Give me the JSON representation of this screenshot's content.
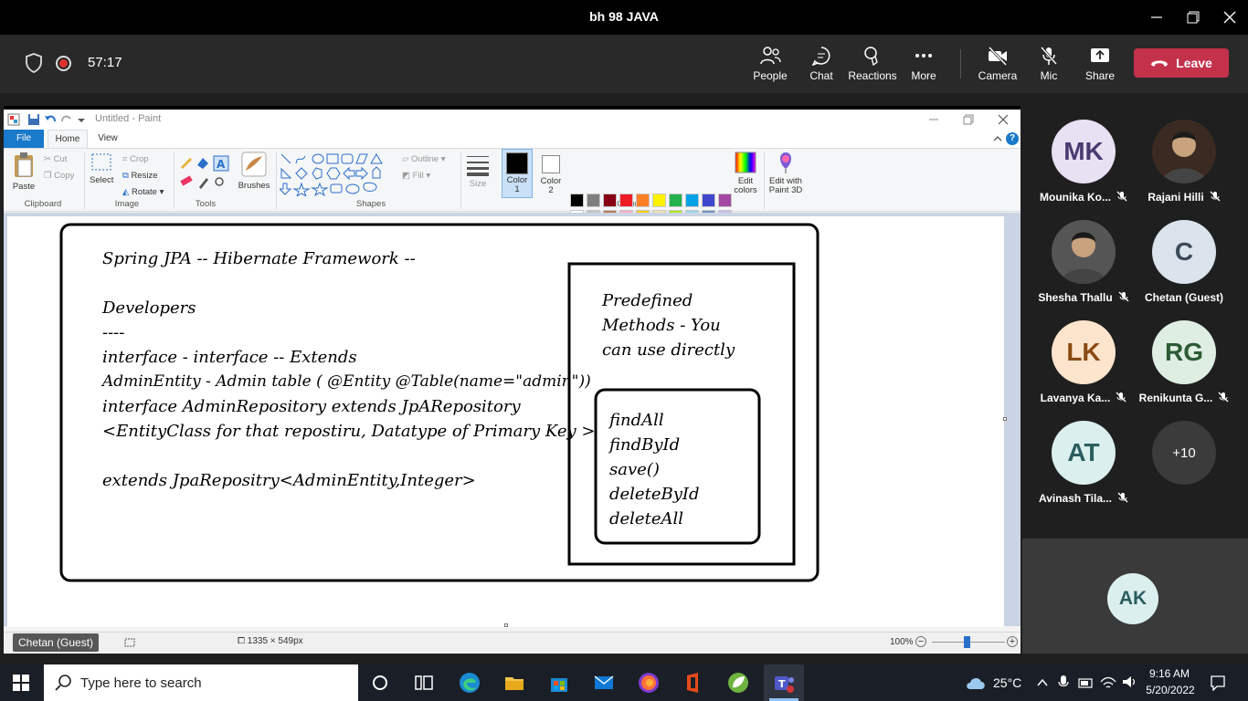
{
  "window": {
    "title": "bh 98 JAVA"
  },
  "meeting": {
    "timer": "57:17",
    "buttons": {
      "people": "People",
      "chat": "Chat",
      "reactions": "Reactions",
      "more": "More",
      "camera": "Camera",
      "mic": "Mic",
      "share": "Share"
    },
    "leave_label": "Leave",
    "leave_color": "#c4314b"
  },
  "paint": {
    "window_title": "Untitled - Paint",
    "tabs": {
      "file": "File",
      "home": "Home",
      "view": "View"
    },
    "ribbon": {
      "clipboard": {
        "paste": "Paste",
        "cut": "Cut",
        "copy": "Copy",
        "label": "Clipboard"
      },
      "image": {
        "select": "Select",
        "crop": "Crop",
        "resize": "Resize",
        "rotate": "Rotate",
        "label": "Image"
      },
      "tools": {
        "label": "Tools"
      },
      "brushes": {
        "label": "Brushes"
      },
      "shapes": {
        "outline": "Outline",
        "fill": "Fill",
        "label": "Shapes"
      },
      "size": {
        "label": "Size"
      },
      "colors": {
        "color1": "Color",
        "color1_num": "1",
        "color2": "Color",
        "color2_num": "2",
        "edit": "Edit",
        "edit2": "colors",
        "label": "Colors",
        "palette_row1": [
          "#000000",
          "#7f7f7f",
          "#880015",
          "#ed1c24",
          "#ff7f27",
          "#fff200",
          "#22b14c",
          "#00a2e8",
          "#3f48cc",
          "#a349a4"
        ],
        "palette_row2": [
          "#ffffff",
          "#c3c3c3",
          "#b97a57",
          "#ffaec9",
          "#ffc90e",
          "#efe4b0",
          "#b5e61d",
          "#99d9ea",
          "#7092be",
          "#c8bfe7"
        ]
      },
      "paint3d": {
        "line1": "Edit with",
        "line2": "Paint 3D"
      }
    },
    "drawing": {
      "title": "Spring JPA -- Hibernate Framework --",
      "lines": [
        "Developers",
        "----",
        "interface - interface -- Extends",
        "AdminEntity - Admin table  ( @Entity @Table(name=\"admin\"))",
        "interface AdminRepository extends JpARepository",
        "<EntityClass for that repostiru, Datatype of Primary Key >",
        "",
        "extends JpaRepositry<AdminEntity,Integer>"
      ],
      "box_text": [
        "Predefined",
        "Methods - You",
        "can use directly"
      ],
      "methods": [
        "findAll",
        "findById",
        "save()",
        "deleteById",
        "deleteAll"
      ]
    },
    "status": {
      "dimensions": "1335 × 549px",
      "zoom": "100%"
    },
    "presenter_chip": "Chetan (Guest)"
  },
  "participants": [
    {
      "initials": "MK",
      "name": "Mounika Ko...",
      "bg": "#e8e1f3",
      "fg": "#4a3a70",
      "muted": true
    },
    {
      "initials": "",
      "name": "Rajani Hilli",
      "bg": "#3a2a22",
      "fg": "#fff",
      "muted": true,
      "photo": true
    },
    {
      "initials": "",
      "name": "Shesha Thallu",
      "bg": "#555",
      "fg": "#fff",
      "muted": true,
      "photo": true
    },
    {
      "initials": "C",
      "name": "Chetan (Guest)",
      "bg": "#dbe4ec",
      "fg": "#3c4b59",
      "muted": false
    },
    {
      "initials": "LK",
      "name": "Lavanya Ka...",
      "bg": "#fde4cc",
      "fg": "#8a4a12",
      "muted": true
    },
    {
      "initials": "RG",
      "name": "Renikunta G...",
      "bg": "#dfeee2",
      "fg": "#2c5a37",
      "muted": true
    },
    {
      "initials": "AT",
      "name": "Avinash Tila...",
      "bg": "#dcefef",
      "fg": "#2a5e60",
      "muted": true
    },
    {
      "initials": "+10",
      "name": "",
      "bg": "#3b3b3b",
      "fg": "#fff",
      "muted": false
    }
  ],
  "self": {
    "initials": "AK"
  },
  "taskbar": {
    "search_placeholder": "Type here to search",
    "weather": "25°C",
    "time": "9:16 AM",
    "date": "5/20/2022"
  }
}
